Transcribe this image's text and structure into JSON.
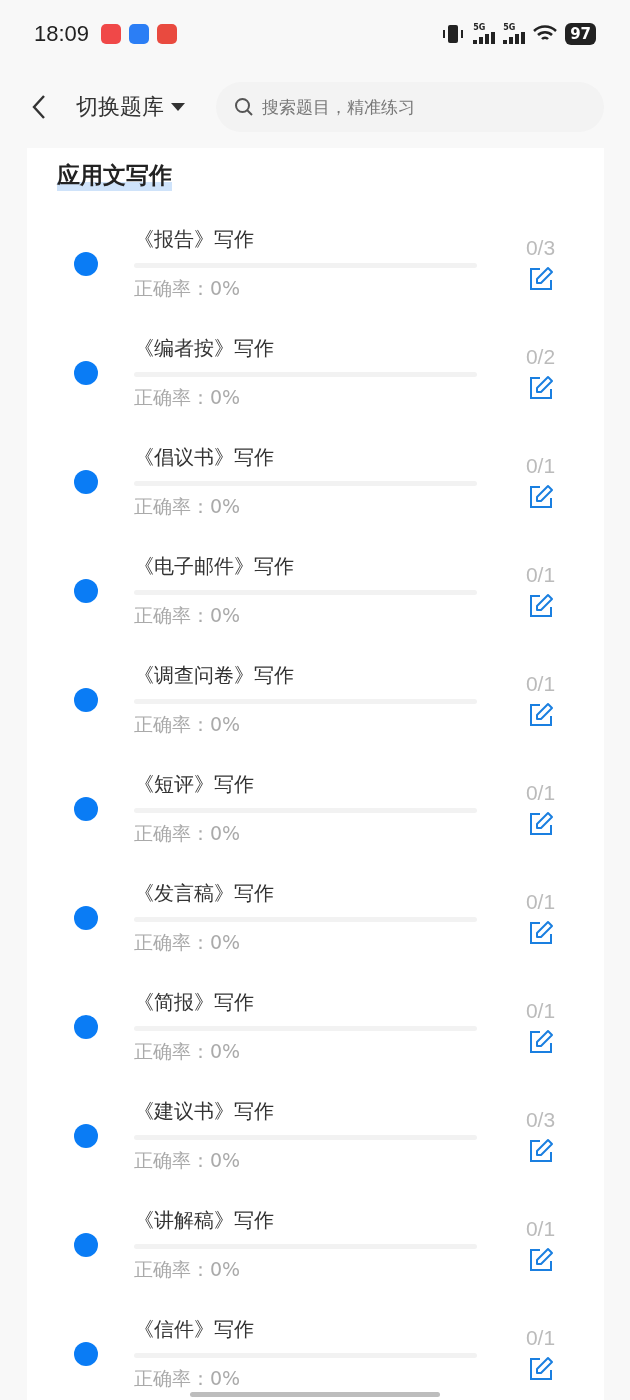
{
  "status_bar": {
    "time": "18:09",
    "battery": "97",
    "network": [
      "5G",
      "5G"
    ]
  },
  "header": {
    "title": "切换题库",
    "search": {
      "placeholder": "搜索题目，精准练习"
    }
  },
  "section": {
    "title": "应用文写作",
    "items": [
      {
        "title": "《报告》写作",
        "accuracy": "正确率：0%",
        "count": "0/3",
        "level": 0
      },
      {
        "title": "《编者按》写作",
        "accuracy": "正确率：0%",
        "count": "0/2",
        "level": 0
      },
      {
        "title": "《倡议书》写作",
        "accuracy": "正确率：0%",
        "count": "0/1",
        "level": 0
      },
      {
        "title": "《电子邮件》写作",
        "accuracy": "正确率：0%",
        "count": "0/1",
        "level": 0
      },
      {
        "title": "《调查问卷》写作",
        "accuracy": "正确率：0%",
        "count": "0/1",
        "level": 0
      },
      {
        "title": "《短评》写作",
        "accuracy": "正确率：0%",
        "count": "0/1",
        "level": 0
      },
      {
        "title": "《发言稿》写作",
        "accuracy": "正确率：0%",
        "count": "0/1",
        "level": 0
      },
      {
        "title": "《简报》写作",
        "accuracy": "正确率：0%",
        "count": "0/1",
        "level": 0
      },
      {
        "title": "《建议书》写作",
        "accuracy": "正确率：0%",
        "count": "0/3",
        "level": 0
      },
      {
        "title": "《讲解稿》写作",
        "accuracy": "正确率：0%",
        "count": "0/1",
        "level": 0
      },
      {
        "title": "《信件》写作",
        "accuracy": "正确率：0%",
        "count": "0/1",
        "level": 0
      }
    ]
  }
}
